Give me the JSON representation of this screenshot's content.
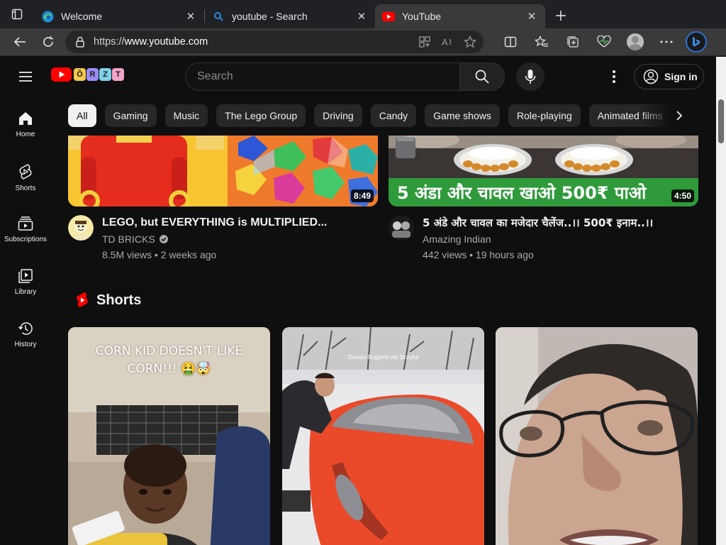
{
  "browser": {
    "tabs": [
      {
        "title": "Welcome",
        "icon": "edge-icon",
        "active": false
      },
      {
        "title": "youtube - Search",
        "icon": "search-icon",
        "active": false
      },
      {
        "title": "YouTube",
        "icon": "youtube-icon",
        "active": true
      }
    ],
    "url_prefix": "https://",
    "url_host": "www.youtube.com"
  },
  "header": {
    "search_placeholder": "Search",
    "sign_in": "Sign in",
    "doodle_letters": [
      "Ô",
      "R",
      "Z",
      "T"
    ]
  },
  "guide": {
    "items": [
      {
        "label": "Home",
        "icon": "home-icon"
      },
      {
        "label": "Shorts",
        "icon": "shorts-icon"
      },
      {
        "label": "Subscriptions",
        "icon": "subscriptions-icon"
      },
      {
        "label": "Library",
        "icon": "library-icon"
      },
      {
        "label": "History",
        "icon": "history-icon"
      }
    ]
  },
  "chips": [
    "All",
    "Gaming",
    "Music",
    "The Lego Group",
    "Driving",
    "Candy",
    "Game shows",
    "Role-playing",
    "Animated films"
  ],
  "videos": [
    {
      "title": "LEGO, but EVERYTHING is MULTIPLIED...",
      "channel": "TD BRICKS",
      "verified": true,
      "stats": "8.5M views • 2 weeks ago",
      "duration": "8:49"
    },
    {
      "title": "5 अंडे और चावल का मजेदार चैलेंज..।। 500₹ इनाम..।।",
      "channel": "Amazing Indian",
      "verified": false,
      "stats": "442 views • 19 hours ago",
      "duration": "4:50",
      "thumb_text": "5 अंडा और चावल खाओ 500₹ पाओ"
    }
  ],
  "shorts": {
    "heading": "Shorts",
    "items": [
      {
        "caption": "CORN KID DOESN'T LIKE CORN!!! 🤮🤯"
      },
      {
        "caption": "Donata Bugiene via Storyful"
      },
      {
        "caption": ""
      }
    ]
  },
  "colors": {
    "accent_red": "#ff0000",
    "background": "#0f0f0f",
    "chip_bg": "#272727",
    "thumb_green": "#2f9a3a"
  }
}
